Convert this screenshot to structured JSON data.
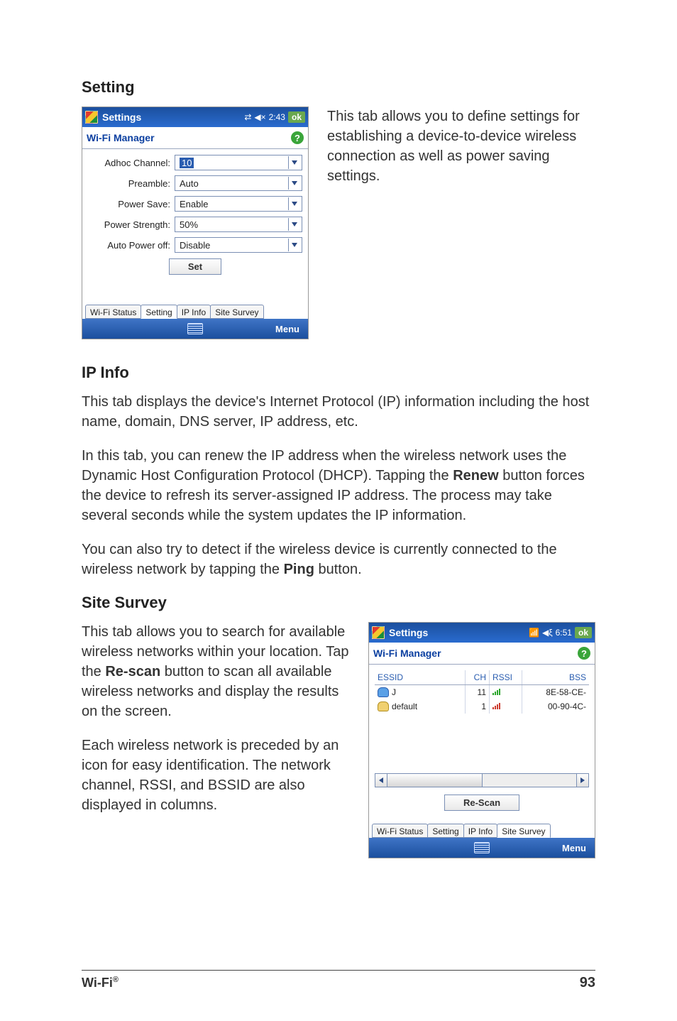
{
  "sections": {
    "setting": {
      "heading": "Setting",
      "paragraph": "This tab allows you to define settings for establishing a device-to-device wireless connection as well as power saving settings."
    },
    "ipinfo": {
      "heading": "IP Info",
      "p1": "This tab displays the device's Internet Protocol (IP) information including the host name, domain, DNS server, IP address, etc.",
      "p2a": "In this tab, you can renew the IP address when the wireless network uses the Dynamic Host Configuration Protocol (DHCP). Tapping the ",
      "p2b": "Renew",
      "p2c": " button forces the device to refresh its server-assigned IP address. The process may take several seconds while the system updates the IP information.",
      "p3a": "You can also try to detect if the wireless device is currently connected to the wireless network by tapping the ",
      "p3b": "Ping",
      "p3c": " button."
    },
    "sitesurvey": {
      "heading": "Site Survey",
      "p1a": "This tab allows you to search for available wireless networks within your location. Tap the ",
      "p1b": "Re-scan",
      "p1c": " button to scan all available wireless networks and display the results on the screen.",
      "p2": "Each wireless network is preceded by an icon for easy identification. The network channel, RSSI, and BSSID are also displayed in columns."
    }
  },
  "shot_setting": {
    "titlebar": {
      "title": "Settings",
      "time": "2:43",
      "ok": "ok"
    },
    "subhead": {
      "label": "Wi-Fi Manager",
      "help": "?"
    },
    "fields": {
      "adhoc": {
        "label": "Adhoc Channel:",
        "value": "10"
      },
      "preamble": {
        "label": "Preamble:",
        "value": "Auto"
      },
      "psave": {
        "label": "Power Save:",
        "value": "Enable"
      },
      "pstr": {
        "label": "Power Strength:",
        "value": "50%"
      },
      "apoff": {
        "label": "Auto Power off:",
        "value": "Disable"
      }
    },
    "set_button": "Set",
    "tabs": [
      "Wi-Fi Status",
      "Setting",
      "IP Info",
      "Site Survey"
    ],
    "active_tab_index": 1,
    "bottom_menu": "Menu"
  },
  "shot_sitesurvey": {
    "titlebar": {
      "title": "Settings",
      "time": "6:51",
      "ok": "ok"
    },
    "subhead": {
      "label": "Wi-Fi Manager",
      "help": "?"
    },
    "columns": {
      "essid": "ESSID",
      "ch": "CH",
      "rssi": "RSSI",
      "bssid": "BSS"
    },
    "rows": [
      {
        "icon": "secure",
        "essid": "J",
        "ch": "11",
        "rssi": "green",
        "bssid": "8E-58-CE-"
      },
      {
        "icon": "open",
        "essid": "default",
        "ch": "1",
        "rssi": "red",
        "bssid": "00-90-4C-"
      }
    ],
    "rescan_button": "Re-Scan",
    "tabs": [
      "Wi-Fi Status",
      "Setting",
      "IP Info",
      "Site Survey"
    ],
    "active_tab_index": 3,
    "bottom_menu": "Menu"
  },
  "footer": {
    "left_a": "Wi-Fi",
    "left_b": "®",
    "right": "93"
  }
}
